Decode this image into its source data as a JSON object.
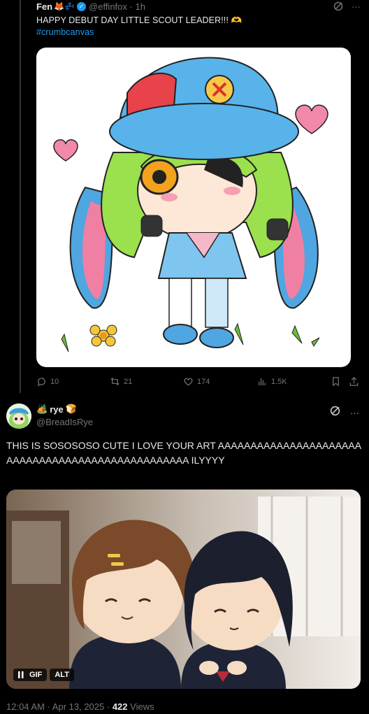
{
  "reply_to": {
    "author_name": "Fen",
    "name_emojis": "🦊💤",
    "handle": "@effinfox",
    "time": "1h",
    "text": "HAPPY DEBUT DAY LITTLE SCOUT LEADER!!! 🫶",
    "hashtag": "#crumbcanvas",
    "stats": {
      "replies": "10",
      "reposts": "21",
      "likes": "174",
      "views": "1.5K"
    }
  },
  "post": {
    "author_name": "rye",
    "name_emoji_prefix": "🏕️",
    "name_emoji_suffix": "🍞",
    "handle": "@BreadIsRye",
    "text": "THIS IS SOSOSOSO CUTE I LOVE YOUR ART AAAAAAAAAAAAAAAAAAAAAAAAAAAAAAAAAAAAAAAAAAAAAAAAAA ILYYYY",
    "gif_badge": "GIF",
    "alt_badge": "ALT",
    "time": "12:04 AM",
    "date": "Apr 13, 2025",
    "views": "422",
    "views_label": "Views"
  },
  "icons": {
    "reply": "reply-icon",
    "repost": "repost-icon",
    "like": "like-icon",
    "views": "views-icon",
    "bookmark": "bookmark-icon",
    "share": "share-icon",
    "grok": "grok-icon",
    "more": "more-icon",
    "pause": "pause-icon"
  },
  "colors": {
    "accent": "#1d9bf0",
    "muted": "#71767b",
    "text": "#e7e9ea",
    "background": "#000000"
  }
}
